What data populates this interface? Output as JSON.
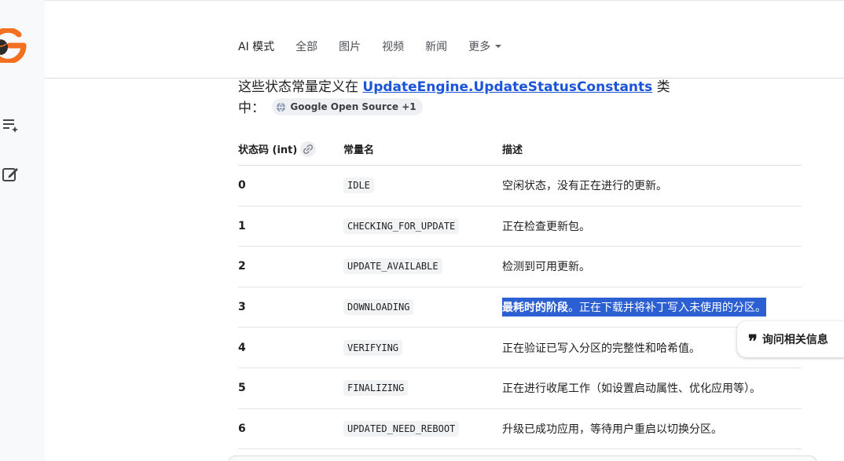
{
  "tabs": [
    {
      "label": "AI 模式",
      "active": true
    },
    {
      "label": "全部"
    },
    {
      "label": "图片"
    },
    {
      "label": "视频"
    },
    {
      "label": "新闻"
    },
    {
      "label": "更多"
    }
  ],
  "intro": {
    "prefix": "这些状态常量定义在 ",
    "link": "UpdateEngine.UpdateStatusConstants",
    "suffix": " 类",
    "line2": "中：",
    "source_chip": "Google Open Source +1"
  },
  "table": {
    "headers": [
      "状态码 (int)",
      "常量名",
      "描述"
    ],
    "rows": [
      {
        "code": "0",
        "name": "IDLE",
        "desc": "空闲状态，没有正在进行的更新。"
      },
      {
        "code": "1",
        "name": "CHECKING_FOR_UPDATE",
        "desc": "正在检查更新包。"
      },
      {
        "code": "2",
        "name": "UPDATE_AVAILABLE",
        "desc": "检测到可用更新。"
      },
      {
        "code": "3",
        "name": "DOWNLOADING",
        "desc_bold": "最耗时的阶段",
        "desc_rest": "。正在下载并将补丁写入未使用的分区。"
      },
      {
        "code": "4",
        "name": "VERIFYING",
        "desc": "正在验证已写入分区的完整性和哈希值。"
      },
      {
        "code": "5",
        "name": "FINALIZING",
        "desc": "正在进行收尾工作（如设置启动属性、优化应用等）。"
      },
      {
        "code": "6",
        "name": "UPDATED_NEED_REBOOT",
        "desc": "升级已成功应用，等待用户重启以切换分区。"
      }
    ]
  },
  "ask_button": {
    "label": "询问相关信息"
  },
  "colors": {
    "accent": "#1a54d8",
    "highlight": "#2c5fd1",
    "logo_orange": "#f37021"
  }
}
